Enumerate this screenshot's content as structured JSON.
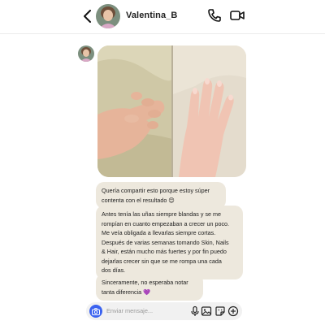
{
  "header": {
    "username": "Valentina_B",
    "icons": [
      "chevron-left-icon",
      "phone-icon",
      "video-camera-icon"
    ]
  },
  "conversation": {
    "messages": [
      {
        "text": "Quería compartir esto porque estoy súper\ncontenta con el resultado 😊"
      },
      {
        "text": "Antes tenía las uñas siempre blandas y se me\nrompían en cuanto empezaban a crecer un poco.\nMe veía obligada a llevarlas siempre cortas.\nDespués de varias semanas tomando Skin, Nails\n& Hair, están mucho más fuertes y por fin puedo\ndejarlas crecer sin que se me rompa una cada\ndos días."
      },
      {
        "text": "Sinceramente, no esperaba notar\ntanta diferencia 💜"
      }
    ]
  },
  "composer": {
    "placeholder": "Enviar mensaje..."
  },
  "colors": {
    "bubble": "#ede8dd",
    "camera_button": "#3b63f0"
  }
}
